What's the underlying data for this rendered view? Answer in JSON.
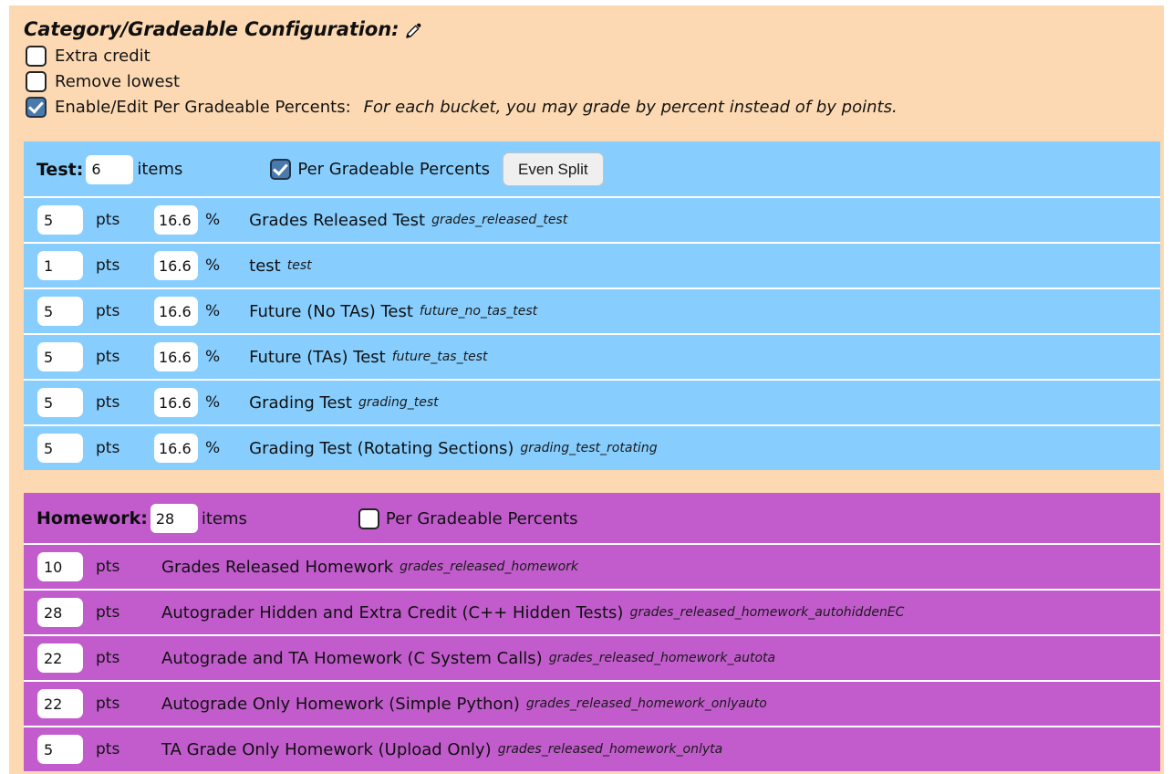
{
  "config": {
    "title": "Category/Gradeable Configuration:",
    "edit_icon": "pencil-icon",
    "options": [
      {
        "label": "Extra credit",
        "checked": false,
        "hint": ""
      },
      {
        "label": "Remove lowest",
        "checked": false,
        "hint": ""
      },
      {
        "label": "Enable/Edit Per Gradeable Percents:",
        "checked": true,
        "hint": "For each bucket, you may grade by percent instead of by points."
      }
    ]
  },
  "buckets": [
    {
      "name": "Test:",
      "items_value": "6",
      "items_label": "items",
      "per_gradeable_percents_label": "Per Gradeable Percents",
      "per_gradeable_percents_checked": true,
      "even_split_label": "Even Split",
      "show_even_split": true,
      "show_percent": true,
      "color": "#87ceff",
      "pts_label": "pts",
      "pct_label": "%",
      "rows": [
        {
          "pts": "5",
          "pct": "16.6",
          "title": "Grades Released Test",
          "id": "grades_released_test"
        },
        {
          "pts": "1",
          "pct": "16.6",
          "title": "test",
          "id": "test"
        },
        {
          "pts": "5",
          "pct": "16.6",
          "title": "Future (No TAs) Test",
          "id": "future_no_tas_test"
        },
        {
          "pts": "5",
          "pct": "16.6",
          "title": "Future (TAs) Test",
          "id": "future_tas_test"
        },
        {
          "pts": "5",
          "pct": "16.6",
          "title": "Grading Test",
          "id": "grading_test"
        },
        {
          "pts": "5",
          "pct": "16.6",
          "title": "Grading Test (Rotating Sections)",
          "id": "grading_test_rotating"
        }
      ]
    },
    {
      "name": "Homework:",
      "items_value": "28",
      "items_label": "items",
      "per_gradeable_percents_label": "Per Gradeable Percents",
      "per_gradeable_percents_checked": false,
      "even_split_label": "Even Split",
      "show_even_split": false,
      "show_percent": false,
      "color": "#c25ccd",
      "pts_label": "pts",
      "pct_label": "%",
      "rows": [
        {
          "pts": "10",
          "pct": "",
          "title": "Grades Released Homework",
          "id": "grades_released_homework"
        },
        {
          "pts": "28",
          "pct": "",
          "title": "Autograder Hidden and Extra Credit (C++ Hidden Tests)",
          "id": "grades_released_homework_autohiddenEC"
        },
        {
          "pts": "22",
          "pct": "",
          "title": "Autograde and TA Homework (C System Calls)",
          "id": "grades_released_homework_autota"
        },
        {
          "pts": "22",
          "pct": "",
          "title": "Autograde Only Homework (Simple Python)",
          "id": "grades_released_homework_onlyauto"
        },
        {
          "pts": "5",
          "pct": "",
          "title": "TA Grade Only Homework (Upload Only)",
          "id": "grades_released_homework_onlyta"
        }
      ]
    }
  ],
  "colors": {
    "page_background": "#fcd9b2",
    "test_bucket": "#87ceff",
    "homework_bucket": "#c25ccd",
    "checkbox_checked": "#4a7aab",
    "button_background": "#efefef"
  }
}
